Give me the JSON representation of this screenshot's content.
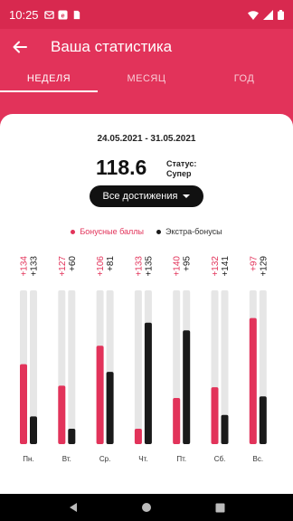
{
  "status_bar": {
    "time": "10:25",
    "left_icons": [
      "message-icon",
      "app-icon",
      "sim-icon"
    ],
    "right_icons": [
      "wifi-icon",
      "signal-icon",
      "battery-icon"
    ]
  },
  "app_bar": {
    "title": "Ваша статистика",
    "back_icon": "arrow-left-icon"
  },
  "tabs": [
    {
      "label": "НЕДЕЛЯ",
      "active": true
    },
    {
      "label": "МЕСЯЦ",
      "active": false
    },
    {
      "label": "ГОД",
      "active": false
    }
  ],
  "summary": {
    "date_range": "24.05.2021 - 31.05.2021",
    "score": "118.6",
    "status_line1": "Статус:",
    "status_line2": "Супер"
  },
  "achievements_button": {
    "label": "Все достижения"
  },
  "legend": {
    "bonus_label": "Бонусные баллы",
    "extra_label": "Экстра-бонусы"
  },
  "colors": {
    "accent": "#e2335a",
    "extra": "#1a1a1a",
    "track": "#e6e6e6"
  },
  "chart_data": {
    "type": "bar",
    "categories": [
      "Пн.",
      "Вт.",
      "Ср.",
      "Чт.",
      "Пт.",
      "Сб.",
      "Вс."
    ],
    "series": [
      {
        "name": "Бонусные баллы",
        "values": [
          134,
          127,
          106,
          133,
          140,
          132,
          97
        ],
        "labels": [
          "+134",
          "+127",
          "+106",
          "+133",
          "+140",
          "+132",
          "+97"
        ],
        "fill": [
          0.52,
          0.38,
          0.64,
          0.1,
          0.3,
          0.37,
          0.82
        ]
      },
      {
        "name": "Экстра-бонусы",
        "values": [
          133,
          60,
          81,
          135,
          95,
          141,
          129
        ],
        "labels": [
          "+133",
          "+60",
          "+81",
          "+135",
          "+95",
          "+141",
          "+129"
        ],
        "fill": [
          0.18,
          0.1,
          0.47,
          0.79,
          0.74,
          0.19,
          0.31
        ]
      }
    ]
  },
  "nav": [
    "back-nav-icon",
    "home-nav-icon",
    "recents-nav-icon"
  ]
}
